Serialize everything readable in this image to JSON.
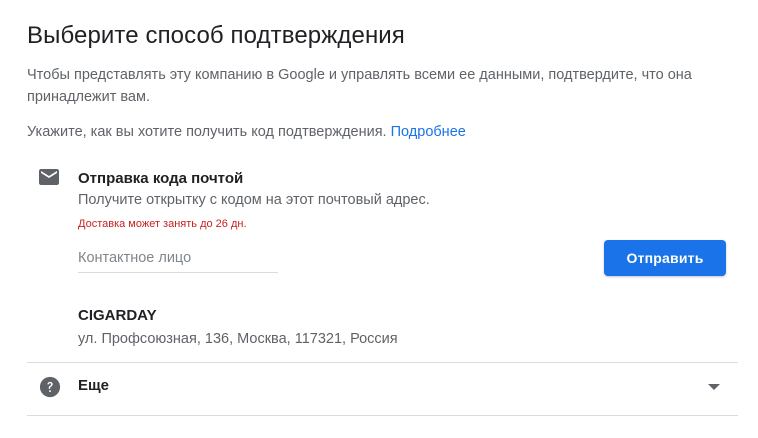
{
  "header": {
    "title": "Выберите способ подтверждения"
  },
  "intro": {
    "description": "Чтобы представлять эту компанию в Google и управлять всеми ее данными, подтвердите, что она принадлежит вам.",
    "prompt": "Укажите, как вы хотите получить код подтверждения.",
    "learn_more_link": "Подробнее"
  },
  "mail_option": {
    "icon": "mail-icon",
    "title": "Отправка кода почтой",
    "subtitle": "Получите открытку с кодом на этот почтовый адрес.",
    "warning": "Доставка может занять до 26 дн.",
    "contact_field": {
      "placeholder": "Контактное лицо",
      "value": ""
    },
    "send_button": "Отправить",
    "business_name": "CIGARDAY",
    "business_address": "ул. Профсоюзная, 136, Москва, 117321, Россия"
  },
  "more_section": {
    "icon": "help-icon",
    "label": "Еще",
    "expand_icon": "chevron-down-icon"
  },
  "colors": {
    "accent": "#1a73e8",
    "warning": "#c5221f",
    "primary_text": "#202124",
    "secondary_text": "#5f6368",
    "icon": "#5f6368",
    "divider": "#dadce0"
  }
}
